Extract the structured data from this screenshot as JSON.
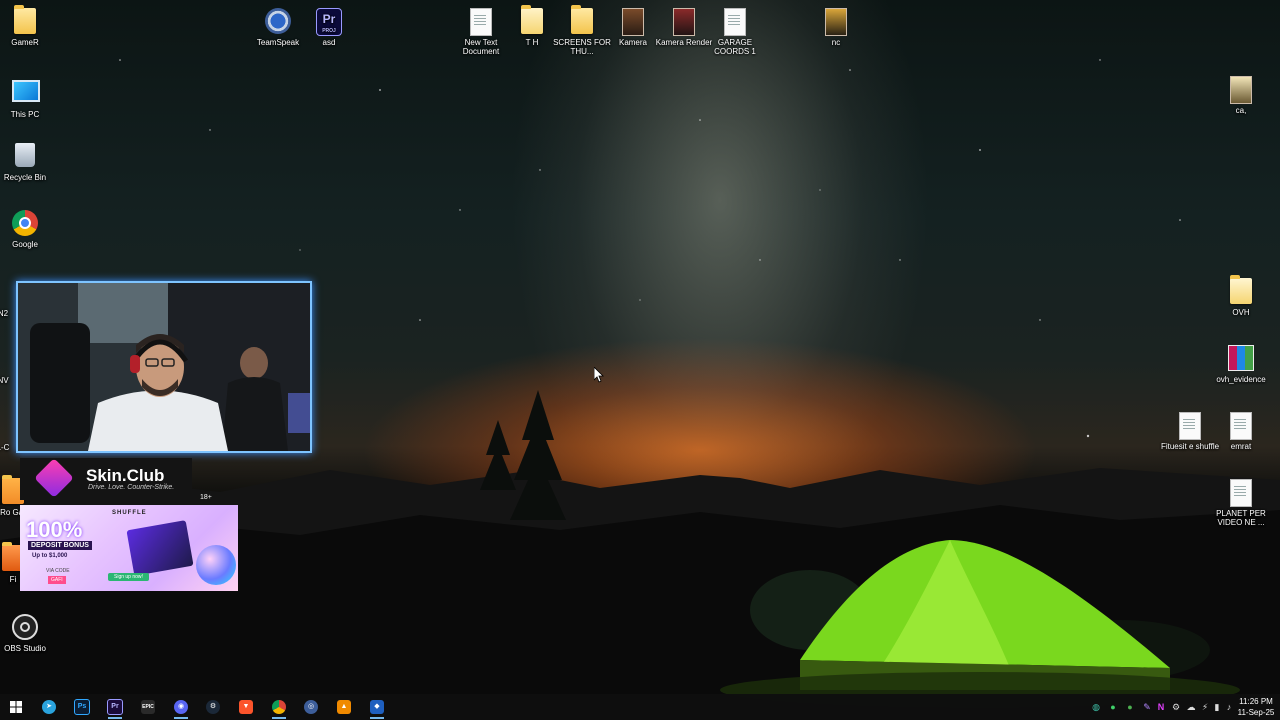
{
  "desktop": {
    "left_icons": [
      {
        "label": "GameR"
      },
      {
        "label": "This PC"
      },
      {
        "label": "Recycle Bin"
      },
      {
        "label": "Google"
      },
      {
        "label": "OBS Studio"
      }
    ],
    "top_icons": [
      {
        "label": "TeamSpeak"
      },
      {
        "label": "asd"
      },
      {
        "label": "New Text Document"
      },
      {
        "label": "T H"
      },
      {
        "label": "SCREENS FOR THU..."
      },
      {
        "label": "Kamera"
      },
      {
        "label": "Kamera Render"
      },
      {
        "label": "GARAGE COORDS 1"
      },
      {
        "label": "nc"
      }
    ],
    "right_icons": [
      {
        "label": "ca,"
      },
      {
        "label": "OVH"
      },
      {
        "label": "ovh_evidence"
      },
      {
        "label": "Fituesit e shuffle"
      },
      {
        "label": "emrat"
      },
      {
        "label": "PLANET PER VIDEO NE ..."
      }
    ],
    "partial_left_labels": [
      "N2",
      "NV",
      "L-C",
      "Ro Gar",
      "Fi"
    ],
    "premiere_badge": {
      "main": "Pr",
      "sub": "PROJ"
    },
    "premiere_badge_app": {
      "main": "Pr"
    }
  },
  "sponsor": {
    "name": "Skin.Club",
    "tagline": "Drive. Love. Counter-Strike.",
    "age": "18+"
  },
  "ad": {
    "brand": "SHUFFLE",
    "headline": "100%",
    "bonus": "DEPOSIT BONUS",
    "upto": "Up to $1,000",
    "code_label": "VIA CODE",
    "code": "GAFI",
    "cta": "Sign up now!"
  },
  "taskbar": {
    "apps": [
      {
        "name": "start",
        "glyph": "⊞"
      },
      {
        "name": "telegram",
        "glyph": "➤"
      },
      {
        "name": "photoshop",
        "glyph": "Ps"
      },
      {
        "name": "premiere",
        "glyph": "Pr"
      },
      {
        "name": "epic-games",
        "glyph": "EPIC"
      },
      {
        "name": "discord",
        "glyph": "◉"
      },
      {
        "name": "steam",
        "glyph": "⚙"
      },
      {
        "name": "brave",
        "glyph": "▼"
      },
      {
        "name": "chrome",
        "glyph": ""
      },
      {
        "name": "teamspeak",
        "glyph": "◎"
      },
      {
        "name": "vlc",
        "glyph": "▲"
      },
      {
        "name": "app",
        "glyph": "◆"
      }
    ],
    "tray_glyphs": [
      "◍",
      "●",
      "●",
      "✎",
      "⚙",
      "N",
      "☁",
      "⚡",
      "▮",
      "⌂",
      "▭",
      "♪"
    ],
    "time": "11:26 PM",
    "date": "11-Sep-25"
  }
}
